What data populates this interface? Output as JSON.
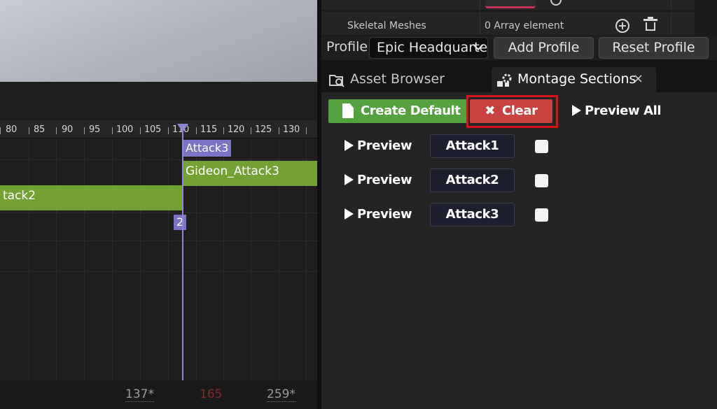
{
  "timeline": {
    "ruler_ticks": [
      "80",
      "85",
      "90",
      "95",
      "100",
      "105",
      "110",
      "115",
      "120",
      "125",
      "130"
    ],
    "section_top": "Attack3",
    "section_bottom": "2",
    "clip_top": "Gideon_Attack3",
    "clip_left": "tack2",
    "frames": {
      "left": "137*",
      "middle": "165",
      "right": "259*"
    }
  },
  "details": {
    "skeletal_meshes_label": "Skeletal Meshes",
    "skeletal_meshes_value": "0 Array element"
  },
  "profile": {
    "label": "Profile",
    "selected": "Epic Headquarters",
    "add_label": "Add Profile",
    "reset_label": "Reset Profile"
  },
  "tabs": {
    "asset_browser": "Asset Browser",
    "montage_sections": "Montage Sections",
    "close_glyph": "×"
  },
  "sections": {
    "create_default": "Create Default",
    "clear": "Clear",
    "clear_glyph": "✖",
    "preview_all": "Preview All",
    "preview_label": "Preview",
    "rows": [
      {
        "name": "Attack1",
        "checked": false
      },
      {
        "name": "Attack2",
        "checked": false
      },
      {
        "name": "Attack3",
        "checked": false
      }
    ]
  },
  "colors": {
    "create_green": "#55a03f",
    "clear_red": "#c94242",
    "highlight_red": "#d6151b",
    "playhead": "#8d86d6",
    "clip_green": "#74a134"
  }
}
